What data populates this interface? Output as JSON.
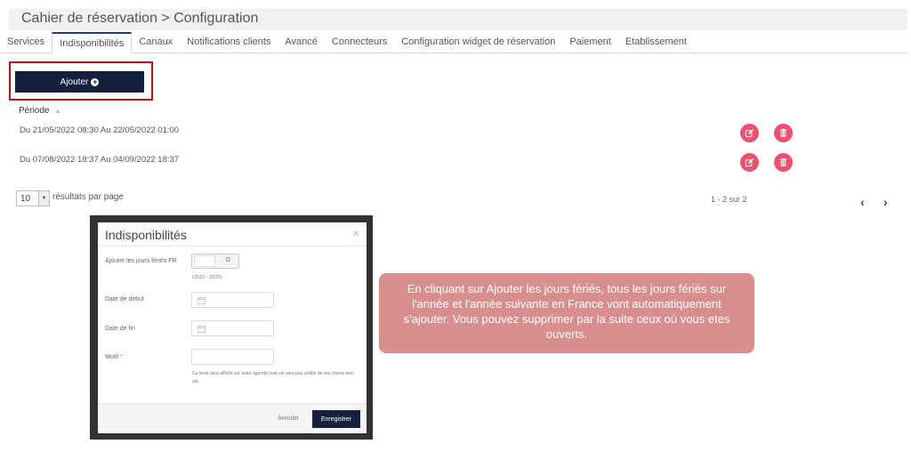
{
  "header": {
    "title": "Cahier de réservation > Configuration"
  },
  "tabs": [
    {
      "label": "Services"
    },
    {
      "label": "Indisponibilités",
      "active": true
    },
    {
      "label": "Canaux"
    },
    {
      "label": "Notifications clients"
    },
    {
      "label": "Avancé"
    },
    {
      "label": "Connecteurs"
    },
    {
      "label": "Configuration widget de réservation"
    },
    {
      "label": "Paiement"
    },
    {
      "label": "Etablissement"
    }
  ],
  "toolbar": {
    "add_label": "Ajouter"
  },
  "table": {
    "column_header": "Période",
    "rows": [
      {
        "period": "Du 21/05/2022 08:30 Au 22/05/2022 01:00"
      },
      {
        "period": "Du 07/08/2022 18:37 Au 04/09/2022 18:37"
      }
    ]
  },
  "pagination": {
    "page_size": "10",
    "page_size_label": "résultats par page",
    "count": "1 - 2 sur 2"
  },
  "modal": {
    "title": "Indisponibilités",
    "close": "×",
    "holidays_label": "Ajouter les jours fériés FR",
    "toggle_state": "O",
    "years_note": "(2022 - 2023)",
    "start_date_label": "Date de début",
    "end_date_label": "Date de fin",
    "reason_label": "Motif",
    "reason_required": "*",
    "reason_help": "Ce texte sera affiché sur votre agenda mais ne sera pas visible de vos clients bien sûr.",
    "cancel_label": "Annuler",
    "save_label": "Enregistrer"
  },
  "callout": {
    "text": "En cliquant sur Ajouter les jours fériés, tous les jours fériés sur l'année et l'année suivante en France vont automatiquement s'ajouter. Vous pouvez supprimer par la suite ceux où vous etes ouverts."
  },
  "colors": {
    "primary": "#13213f",
    "action": "#f0506e",
    "highlight": "#c1121c",
    "callout": "#d98e8e"
  }
}
